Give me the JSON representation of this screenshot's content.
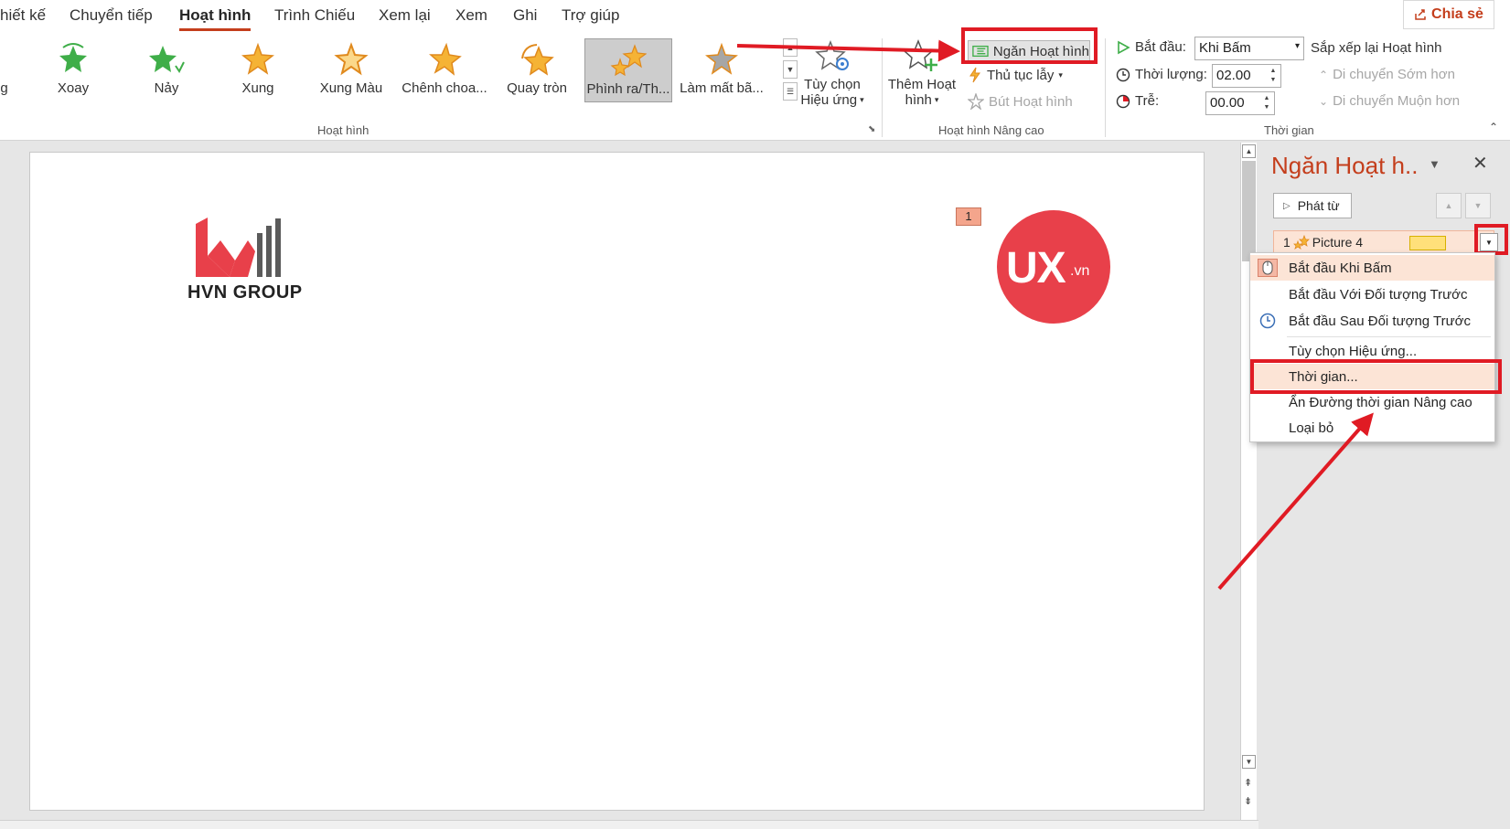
{
  "tabs": [
    {
      "label": "hiết kế"
    },
    {
      "label": "Chuyển tiếp"
    },
    {
      "label": "Hoạt hình"
    },
    {
      "label": "Trình Chiếu"
    },
    {
      "label": "Xem lại"
    },
    {
      "label": "Xem"
    },
    {
      "label": "Ghi"
    },
    {
      "label": "Trợ giúp"
    }
  ],
  "share_label": "Chia sẻ",
  "gallery": {
    "partial_label": "ng",
    "items": [
      {
        "label": "Xoay"
      },
      {
        "label": "Nảy"
      },
      {
        "label": "Xung"
      },
      {
        "label": "Xung Màu"
      },
      {
        "label": "Chênh choa..."
      },
      {
        "label": "Quay tròn"
      },
      {
        "label": "Phình ra/Th..."
      },
      {
        "label": "Làm mất bã..."
      }
    ],
    "effect_options_line1": "Tùy chọn",
    "effect_options_line2": "Hiệu ứng",
    "group_label": "Hoạt hình"
  },
  "advanced": {
    "add_animation_line1": "Thêm Hoạt",
    "add_animation_line2": "hình",
    "animation_pane": "Ngăn Hoạt hình",
    "trigger": "Thủ tục lẫy",
    "painter": "Bút Hoạt hình",
    "group_label": "Hoạt hình Nâng cao"
  },
  "timing": {
    "start_label": "Bắt đầu:",
    "start_value": "Khi Bấm",
    "duration_label": "Thời lượng:",
    "duration_value": "02.00",
    "delay_label": "Trễ:",
    "delay_value": "00.00",
    "reorder_title": "Sắp xếp lại Hoạt hình",
    "move_earlier": "Di chuyển Sớm hơn",
    "move_later": "Di chuyển Muộn hơn",
    "group_label": "Thời gian"
  },
  "slide": {
    "logo_text": "HVN GROUP",
    "anim_tag": "1",
    "ux_text": "UX",
    "ux_suffix": ".vn"
  },
  "pane": {
    "title": "Ngăn Hoạt h..",
    "play_from": "Phát từ",
    "item_number": "1",
    "item_name": "Picture 4"
  },
  "context_menu": {
    "items": [
      {
        "label": "Bắt đầu Khi Bấm"
      },
      {
        "label": "Bắt đầu Với Đối tượng Trước"
      },
      {
        "label": "Bắt đầu Sau Đối tượng Trước"
      },
      {
        "label": "Tùy chọn Hiệu ứng..."
      },
      {
        "label": "Thời gian..."
      },
      {
        "label": "Ẩn Đường thời gian Nâng cao"
      },
      {
        "label": "Loại bỏ"
      }
    ]
  },
  "colors": {
    "accent": "#c43e1c",
    "annotation_red": "#e01b24",
    "ux_circle": "#e8404a",
    "star_green": "#3fae49",
    "star_gold": "#f5b335"
  }
}
